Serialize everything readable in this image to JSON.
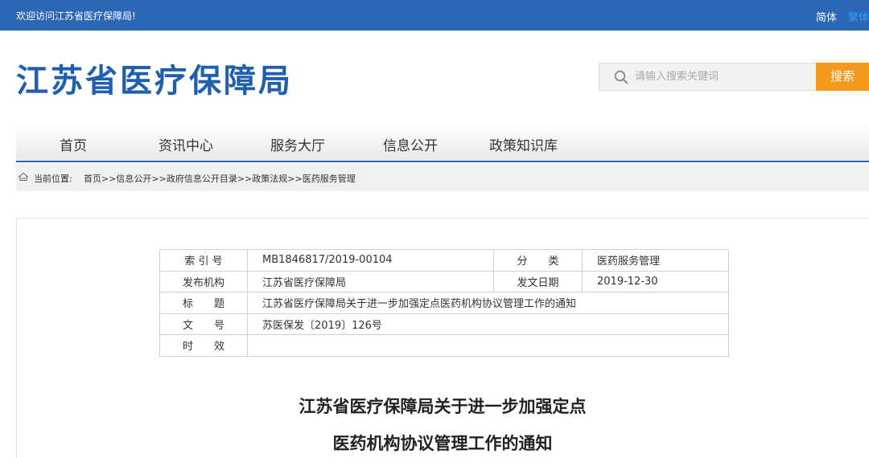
{
  "topbar": {
    "welcome": "欢迎访问江苏省医疗保障局!",
    "lang_simplified": "简体",
    "lang_traditional": "繁体"
  },
  "header": {
    "site_title": "江苏省医疗保障局",
    "search_placeholder": "请输入搜索关键词",
    "search_button": "搜索"
  },
  "nav": {
    "items": [
      "首页",
      "资讯中心",
      "服务大厅",
      "信息公开",
      "政策知识库"
    ]
  },
  "breadcrumb": {
    "label": "当前位置:",
    "path": "首页>>信息公开>>政府信息公开目录>>政策法规>>医药服务管理"
  },
  "meta": {
    "index_label": "索 引 号",
    "index_value": "MB1846817/2019-00104",
    "category_label": "分　　类",
    "category_value": "医药服务管理",
    "issuer_label": "发布机构",
    "issuer_value": "江苏省医疗保障局",
    "date_label": "发文日期",
    "date_value": "2019-12-30",
    "title_label": "标　　题",
    "title_value": "江苏省医疗保障局关于进一步加强定点医药机构协议管理工作的通知",
    "docno_label": "文　　号",
    "docno_value": "苏医保发〔2019〕126号",
    "validity_label": "时　　效",
    "validity_value": ""
  },
  "document": {
    "title_line1": "江苏省医疗保障局关于进一步加强定点",
    "title_line2": "医药机构协议管理工作的通知"
  },
  "colors": {
    "brand_blue": "#2b67b5",
    "search_orange": "#f39a1c"
  }
}
